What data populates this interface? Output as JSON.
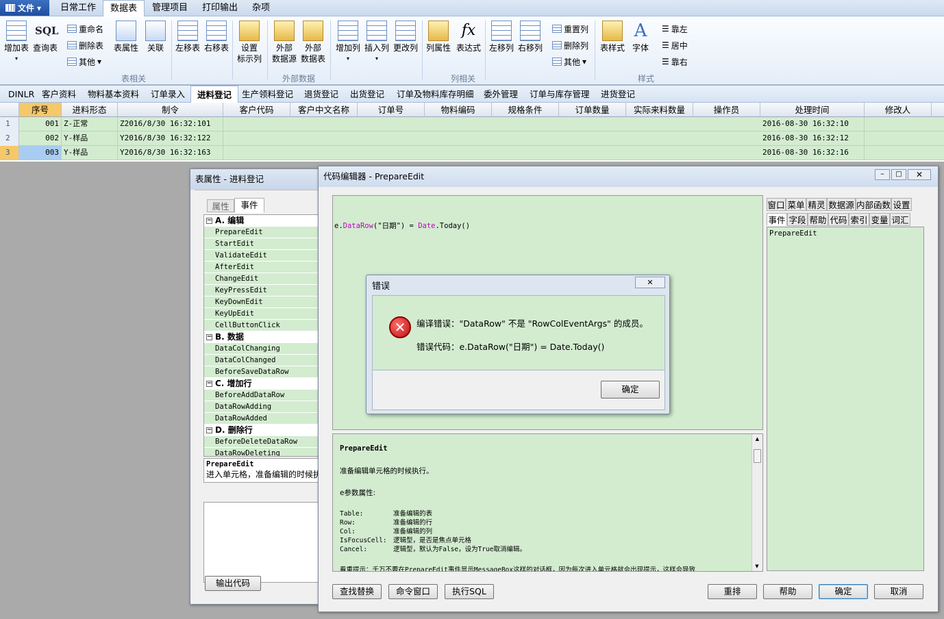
{
  "menubar": {
    "file": "文件",
    "tabs": [
      "日常工作",
      "数据表",
      "管理项目",
      "打印输出",
      "杂项"
    ],
    "active_tab": "数据表"
  },
  "ribbon": {
    "buttons": {
      "add_table": "增加表",
      "query_table": "查询表",
      "rename": "重命名",
      "delete_table": "删除表",
      "other": "其他",
      "table_props": "表属性",
      "relation": "关联",
      "move_left_table": "左移表",
      "move_right_table": "右移表",
      "set_label_col": [
        "设置",
        "标示列"
      ],
      "ext_source": [
        "外部",
        "数据源"
      ],
      "ext_table": [
        "外部",
        "数据表"
      ],
      "add_col": "增加列",
      "insert_col": "插入列",
      "change_col": "更改列",
      "col_props": "列属性",
      "expression": "表达式",
      "move_left_col": "左移列",
      "move_right_col": "右移列",
      "reset_col": "重置列",
      "delete_col": "删除列",
      "other_col": "其他",
      "table_style": "表样式",
      "font": "字体",
      "align_left": "靠左",
      "align_center": "居中",
      "align_right": "靠右"
    },
    "groups": {
      "table": "表相关",
      "external": "外部数据",
      "column": "列相关",
      "style": "样式"
    }
  },
  "sheet_tabs": [
    "DINLR",
    "客户资料",
    "物料基本资料",
    "订单录入",
    "进料登记",
    "生产领料登记",
    "退货登记",
    "出货登记",
    "订单及物料库存明细",
    "委外管理",
    "订单与库存管理",
    "进货登记"
  ],
  "active_sheet": "进料登记",
  "grid": {
    "columns": [
      "序号",
      "进料形态",
      "制令",
      "客户代码",
      "客户中文名称",
      "订单号",
      "物料编码",
      "规格条件",
      "订单数量",
      "实际来料数量",
      "操作员",
      "处理时间",
      "修改人"
    ],
    "rows": [
      {
        "no": "1",
        "seq": "001",
        "form": "Z-正常",
        "order": "Z2016/8/30 16:32:101",
        "time": "2016-08-30 16:32:10"
      },
      {
        "no": "2",
        "seq": "002",
        "form": "Y-样品",
        "order": "Y2016/8/30 16:32:122",
        "time": "2016-08-30 16:32:12"
      },
      {
        "no": "3",
        "seq": "003",
        "form": "Y-样品",
        "order": "Y2016/8/30 16:32:163",
        "time": "2016-08-30 16:32:16"
      }
    ]
  },
  "props_window": {
    "title": "表属性 - 进料登记",
    "tab_props": "属性",
    "tab_events": "事件",
    "categories": [
      {
        "name": "A. 编辑",
        "items": [
          "PrepareEdit",
          "StartEdit",
          "ValidateEdit",
          "AfterEdit",
          "ChangeEdit",
          "KeyPressEdit",
          "KeyDownEdit",
          "KeyUpEdit",
          "CellButtonClick"
        ]
      },
      {
        "name": "B. 数据",
        "items": [
          "DataColChanging",
          "DataColChanged",
          "BeforeSaveDataRow"
        ]
      },
      {
        "name": "C. 增加行",
        "items": [
          "BeforeAddDataRow",
          "DataRowAdding",
          "DataRowAdded"
        ]
      },
      {
        "name": "D. 删除行",
        "items": [
          "BeforeDeleteDataRow",
          "DataRowDeleting"
        ]
      }
    ],
    "desc_title": "PrepareEdit",
    "desc_text": "进入单元格，准备编辑的时候执",
    "export_btn": "输出代码"
  },
  "code_editor": {
    "title": "代码编辑器 - PrepareEdit",
    "code": {
      "p1": "e.",
      "p2": "DataRow",
      "p3": "(\"日期\") = ",
      "p4": "Date",
      "p5": ".Today()"
    },
    "right_tabs_row1": [
      "窗口",
      "菜单",
      "精灵",
      "数据源",
      "内部函数",
      "设置"
    ],
    "right_tabs_row2": [
      "事件",
      "字段",
      "帮助",
      "代码",
      "索引",
      "变量",
      "词汇"
    ],
    "right_list": [
      "PrepareEdit"
    ],
    "help": {
      "title": "PrepareEdit",
      "desc": "准备编辑单元格的时候执行。",
      "params_title": "e参数属性:",
      "params": [
        [
          "Table:",
          "准备编辑的表"
        ],
        [
          "Row:",
          "准备编辑的行"
        ],
        [
          "Col:",
          "准备编辑的列"
        ],
        [
          "IsFocusCell:",
          "逻辑型，是否是焦点单元格"
        ],
        [
          "Cancel:",
          "逻辑型，默认为False，设为True取消编辑。"
        ]
      ],
      "tail": "看重提示：千万不要在PrepareEdit事件显示MessageBox这样的对话框，因为每次进入单元格就会出现提示，这样会导致"
    },
    "buttons": {
      "find": "查找替换",
      "cmd": "命令窗口",
      "sql": "执行SQL",
      "rearrange": "重排",
      "help": "帮助",
      "ok": "确定",
      "cancel": "取消"
    }
  },
  "error_dialog": {
    "title": "错误",
    "message": "编译错误：\"DataRow\" 不是 \"RowColEventArgs\" 的成员。",
    "code_line": "错误代码：e.DataRow(\"日期\") = Date.Today()",
    "ok": "确定"
  }
}
